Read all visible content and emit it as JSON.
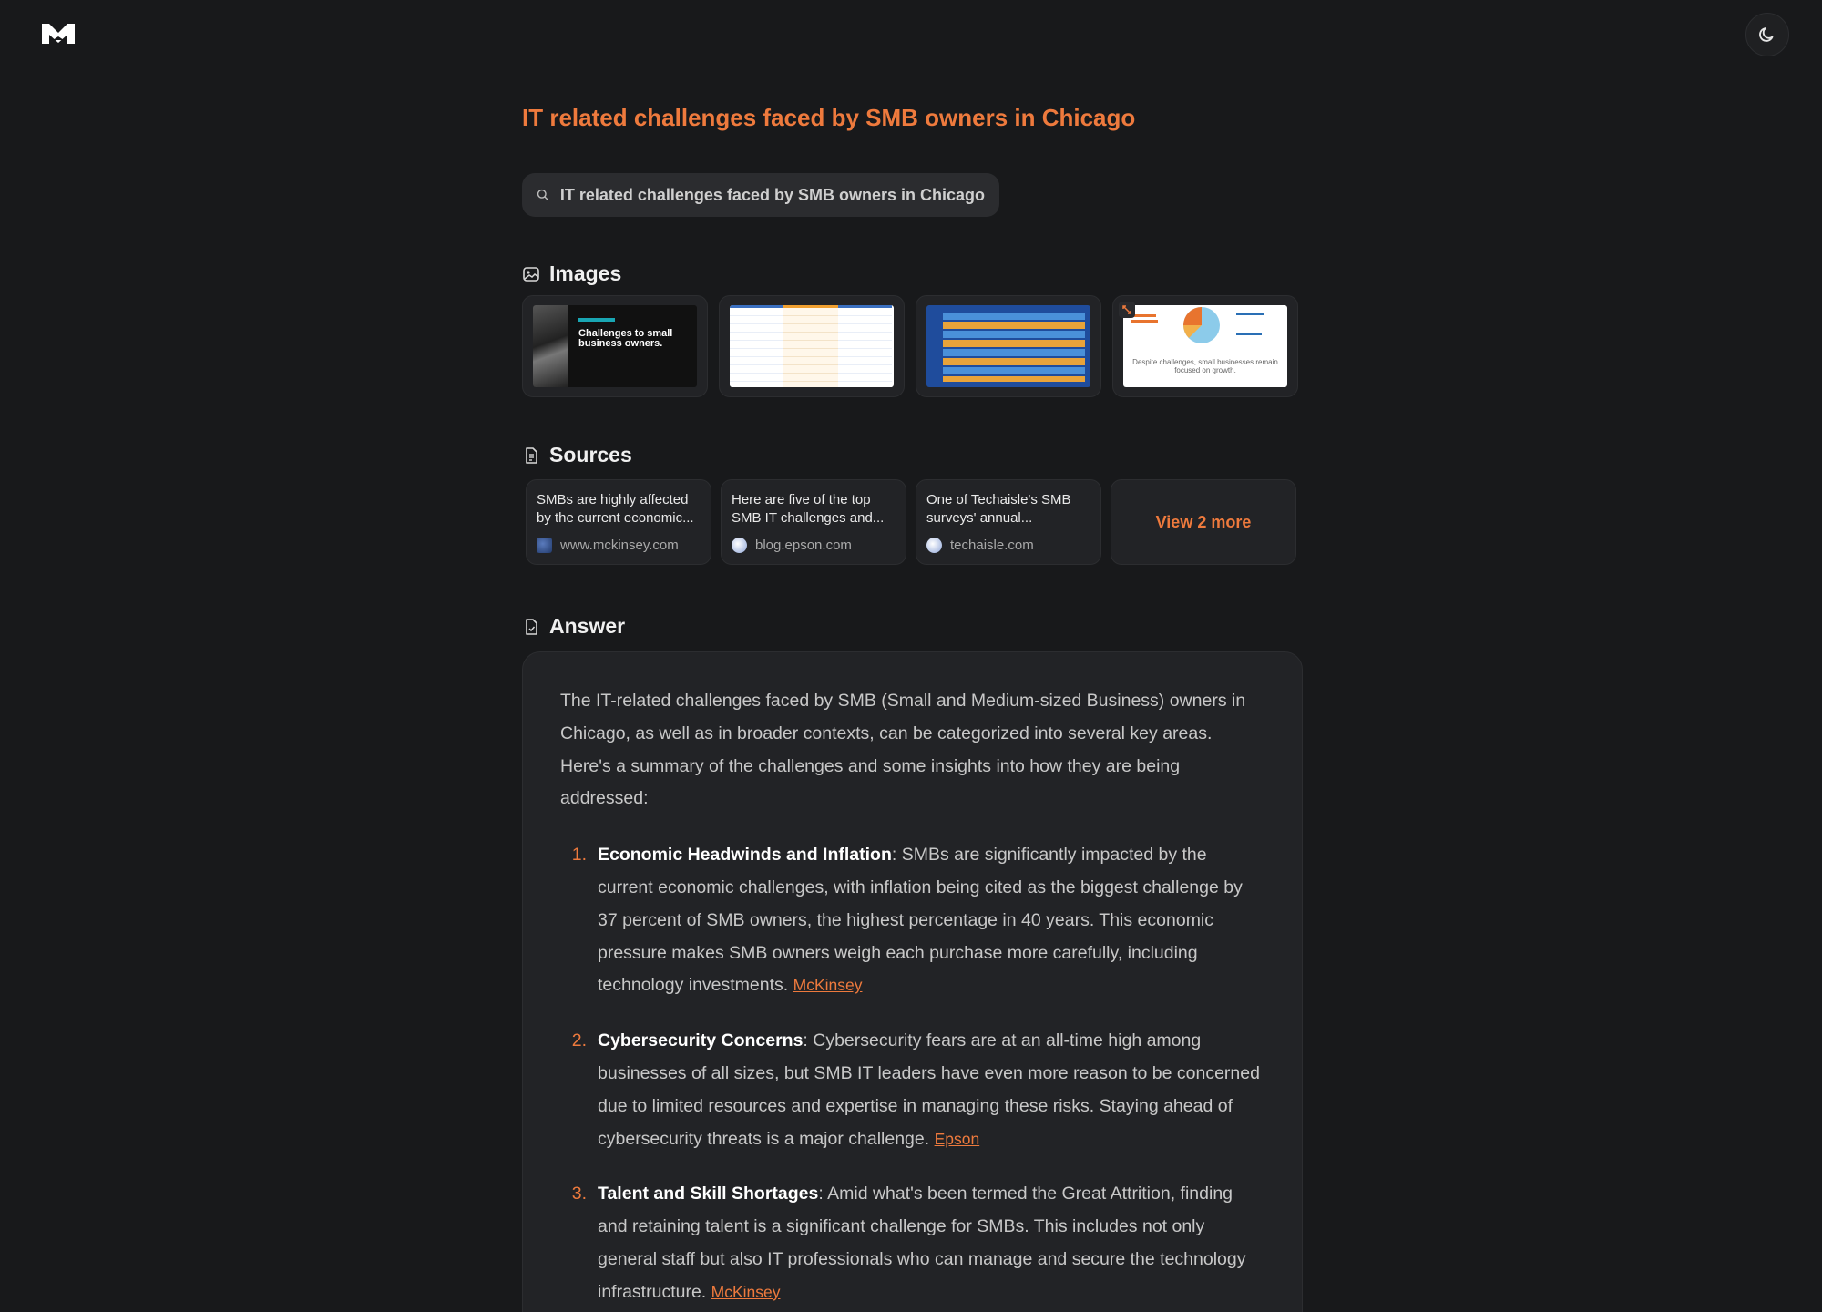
{
  "app": {
    "logo": "M-logo",
    "theme_icon": "moon-icon"
  },
  "query": {
    "title": "IT related challenges faced by SMB owners in Chicago",
    "search_text": "IT related challenges faced by SMB owners in Chicago"
  },
  "sections": {
    "images": "Images",
    "sources": "Sources",
    "answer": "Answer"
  },
  "images": [
    {
      "caption": "Challenges to small business owners."
    },
    {
      "caption": ""
    },
    {
      "caption": ""
    },
    {
      "caption": "Despite challenges, small businesses remain focused on growth."
    }
  ],
  "sources": [
    {
      "snippet": "SMBs are highly affected by the current economic...",
      "domain": "www.mckinsey.com"
    },
    {
      "snippet": "Here are five of the top SMB IT challenges and...",
      "domain": "blog.epson.com"
    },
    {
      "snippet": "One of Techaisle's SMB surveys' annual...",
      "domain": "techaisle.com"
    }
  ],
  "view_more": "View 2 more",
  "answer": {
    "intro": "The IT-related challenges faced by SMB (Small and Medium-sized Business) owners in Chicago, as well as in broader contexts, can be categorized into several key areas. Here's a summary of the challenges and some insights into how they are being addressed:",
    "items": [
      {
        "num": "1.",
        "heading": "Economic Headwinds and Inflation",
        "text": ": SMBs are significantly impacted by the current economic challenges, with inflation being cited as the biggest challenge by 37 percent of SMB owners, the highest percentage in 40 years. This economic pressure makes SMB owners weigh each purchase more carefully, including technology investments. ",
        "cite": "McKinsey"
      },
      {
        "num": "2.",
        "heading": "Cybersecurity Concerns",
        "text": ": Cybersecurity fears are at an all-time high among businesses of all sizes, but SMB IT leaders have even more reason to be concerned due to limited resources and expertise in managing these risks. Staying ahead of cybersecurity threats is a major challenge. ",
        "cite": "Epson"
      },
      {
        "num": "3.",
        "heading": "Talent and Skill Shortages",
        "text": ": Amid what's been termed the Great Attrition, finding and retaining talent is a significant challenge for SMBs. This includes not only general staff but also IT professionals who can manage and secure the technology infrastructure. ",
        "cite": "McKinsey"
      }
    ]
  },
  "colors": {
    "accent": "#ee7a3d",
    "background": "#18191b",
    "card": "#222326"
  }
}
